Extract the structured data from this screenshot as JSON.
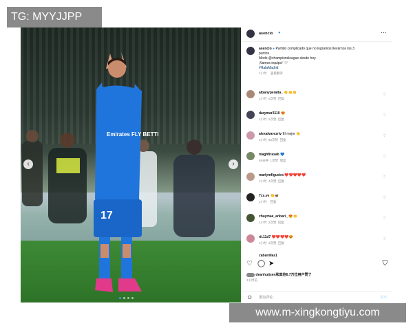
{
  "watermarks": {
    "top": "TG: MYYJJPP",
    "bottom": "www.m-xingkongtiyu.com"
  },
  "post": {
    "author": "asencio",
    "more_icon": "more-icon",
    "caption": {
      "username": "asencio",
      "verified": true,
      "lines": [
        "Partido complicado que no logramos llevarnos los 3",
        "puntos",
        "Modo @championsleague desde hoy.",
        "¡Vamos equipo! 🤍",
        "#HalaMadrid"
      ],
      "time": "1小时",
      "translate": "查看翻译"
    },
    "comments": [
      {
        "user": "albanyperalta_",
        "text": "👏👏👏",
        "time": "1小时",
        "likes": "6次赞",
        "reply": "回复"
      },
      {
        "user": "darymar3110",
        "text": "😍",
        "time": "1小时",
        "likes": "5次赞",
        "reply": "回复"
      },
      {
        "user": "alexalvarezrtv",
        "text": "El mejor 👏",
        "time": "1小时",
        "likes": "90次赞",
        "reply": "回复"
      },
      {
        "user": "maghfirasab",
        "text": "💙",
        "time": "58分钟",
        "likes": "1次赞",
        "reply": "回复"
      },
      {
        "user": "marlymfigueira",
        "text": "❤️❤️❤️❤️❤️",
        "time": "1小时",
        "likes": "4次赞",
        "reply": "回复"
      },
      {
        "user": "7cs.ve",
        "text": "👏🦋",
        "time": "1小时",
        "likes": "",
        "reply": "回复"
      },
      {
        "user": "chaymae_anbari_",
        "text": "😍👏",
        "time": "1小时",
        "likes": "2次赞",
        "reply": "回复"
      },
      {
        "user": "rii.11d7",
        "text": "❤️❤️❤️❤️😍",
        "time": "1小时",
        "likes": "3次赞",
        "reply": "回复"
      },
      {
        "user": "cabanillas1",
        "text": "",
        "time": "",
        "likes": "",
        "reply": ""
      }
    ],
    "likes_text": "deanhuijsen和其他6.7万位用户赞了",
    "posted_time": "1小时前",
    "add_comment_placeholder": "添加评论...",
    "post_button": "发布",
    "jersey_number": "17",
    "jersey_text": "Emirates FLY BETTER"
  },
  "colors": {
    "accent": "#3897f0",
    "kit": "#1e73d8",
    "pitch": "#3d8a36"
  }
}
